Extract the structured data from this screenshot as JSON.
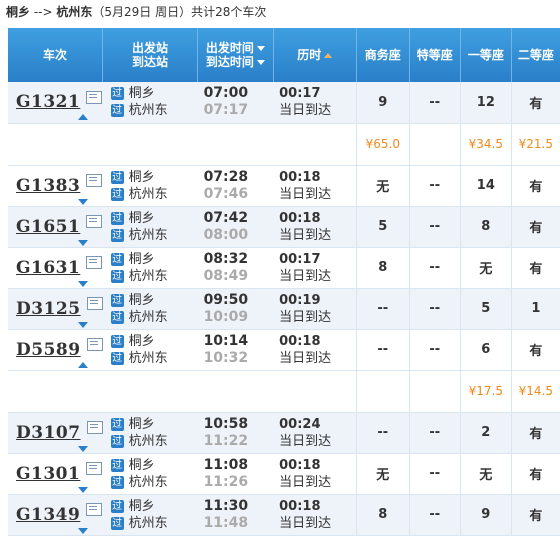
{
  "summary": {
    "from": "桐乡",
    "arrow": "-->",
    "to": "杭州东",
    "date": "（5月29日  周日）",
    "count_text": "共计28个车次"
  },
  "header": {
    "train": "车次",
    "station_l1": "出发站",
    "station_l2": "到达站",
    "time_l1": "出发时间",
    "time_l2": "到达时间",
    "duration": "历时",
    "business": "商务座",
    "special": "特等座",
    "first": "一等座",
    "second": "二等座"
  },
  "trains": [
    {
      "no": "G1321",
      "dir": "up",
      "from": "桐乡",
      "to": "杭州东",
      "dep": "07:00",
      "arr": "07:17",
      "dur": "00:17",
      "note": "当日到达",
      "business": "9",
      "special": "--",
      "first": "12",
      "second": "有",
      "price": {
        "business": "¥65.0",
        "first": "¥34.5",
        "second": "¥21.5"
      }
    },
    {
      "no": "G1383",
      "dir": "down",
      "from": "桐乡",
      "to": "杭州东",
      "dep": "07:28",
      "arr": "07:46",
      "dur": "00:18",
      "note": "当日到达",
      "business": "无",
      "special": "--",
      "first": "14",
      "second": "有"
    },
    {
      "no": "G1651",
      "dir": "down",
      "from": "桐乡",
      "to": "杭州东",
      "dep": "07:42",
      "arr": "08:00",
      "dur": "00:18",
      "note": "当日到达",
      "business": "5",
      "special": "--",
      "first": "8",
      "second": "有"
    },
    {
      "no": "G1631",
      "dir": "down",
      "from": "桐乡",
      "to": "杭州东",
      "dep": "08:32",
      "arr": "08:49",
      "dur": "00:17",
      "note": "当日到达",
      "business": "8",
      "special": "--",
      "first": "无",
      "second": "有"
    },
    {
      "no": "D3125",
      "dir": "down",
      "from": "桐乡",
      "to": "杭州东",
      "dep": "09:50",
      "arr": "10:09",
      "dur": "00:19",
      "note": "当日到达",
      "business": "--",
      "special": "--",
      "first": "5",
      "second": "1"
    },
    {
      "no": "D5589",
      "dir": "up",
      "from": "桐乡",
      "to": "杭州东",
      "dep": "10:14",
      "arr": "10:32",
      "dur": "00:18",
      "note": "当日到达",
      "business": "--",
      "special": "--",
      "first": "6",
      "second": "有",
      "price": {
        "business": "",
        "first": "¥17.5",
        "second": "¥14.5"
      }
    },
    {
      "no": "D3107",
      "dir": "down",
      "from": "桐乡",
      "to": "杭州东",
      "dep": "10:58",
      "arr": "11:22",
      "dur": "00:24",
      "note": "当日到达",
      "business": "--",
      "special": "--",
      "first": "2",
      "second": "有"
    },
    {
      "no": "G1301",
      "dir": "down",
      "from": "桐乡",
      "to": "杭州东",
      "dep": "11:08",
      "arr": "11:26",
      "dur": "00:18",
      "note": "当日到达",
      "business": "无",
      "special": "--",
      "first": "无",
      "second": "有"
    },
    {
      "no": "G1349",
      "dir": "down",
      "from": "桐乡",
      "to": "杭州东",
      "dep": "11:30",
      "arr": "11:48",
      "dur": "00:18",
      "note": "当日到达",
      "business": "8",
      "special": "--",
      "first": "9",
      "second": "有"
    }
  ],
  "labels": {
    "via_badge": "过"
  },
  "colors": {
    "header": "#2a7fc8",
    "available": "#26a306",
    "price": "#f08a1e"
  }
}
